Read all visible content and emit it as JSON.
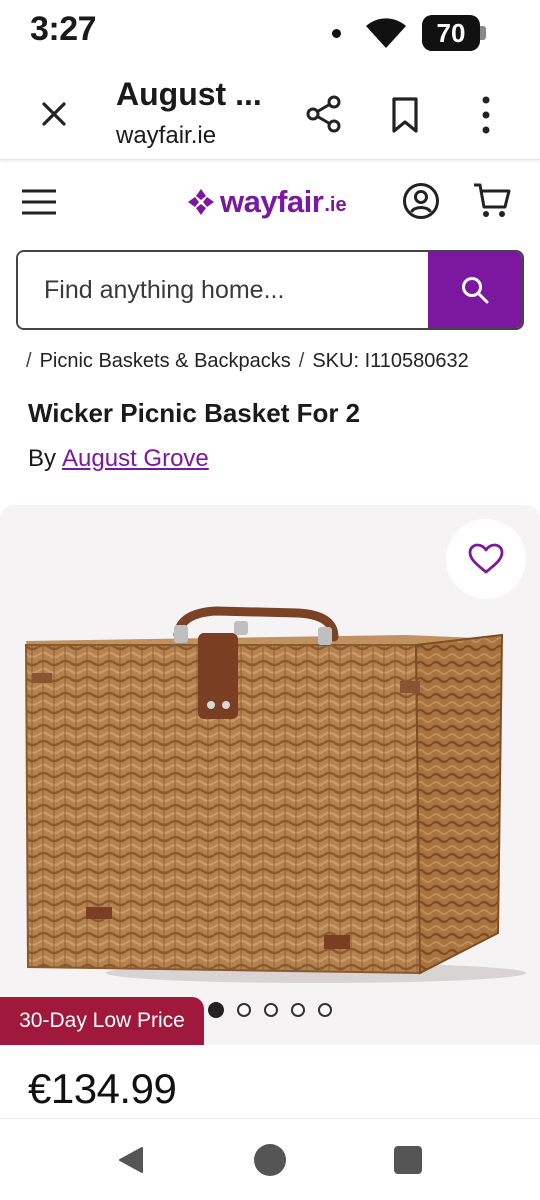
{
  "status_bar": {
    "time": "3:27",
    "battery": "70"
  },
  "browser": {
    "tab_title": "August ...",
    "url": "wayfair.ie"
  },
  "site": {
    "logo_text": "wayfair",
    "logo_tld": ".ie",
    "brand_color": "#7b189f"
  },
  "search": {
    "placeholder": "Find anything home..."
  },
  "breadcrumb": {
    "category": "Picnic Baskets & Backpacks",
    "sku_label": "SKU: I110580632"
  },
  "product": {
    "title": "Wicker Picnic Basket For 2",
    "by_label": "By",
    "brand": "August Grove",
    "badge": "30-Day Low Price",
    "badge_color": "#a0193c",
    "price": "€134.99",
    "carousel": {
      "total_images": 5,
      "active_index": 0
    }
  },
  "icons": {
    "close": "close-icon",
    "share": "share-icon",
    "bookmark": "bookmark-icon",
    "overflow": "overflow-menu-icon",
    "menu": "hamburger-menu-icon",
    "account": "account-icon",
    "cart": "cart-icon",
    "search": "search-icon",
    "favorite": "heart-icon"
  }
}
